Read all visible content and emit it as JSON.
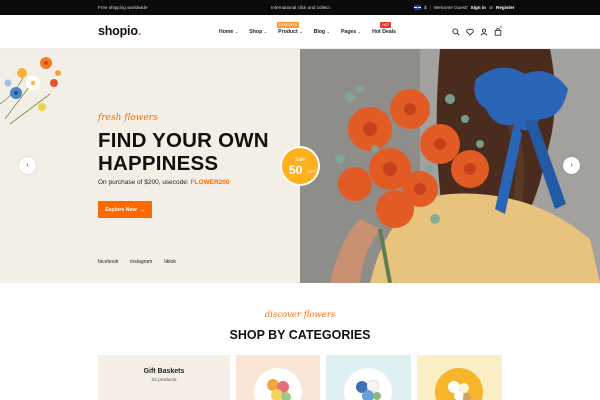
{
  "topbar": {
    "left_text": "Free shipping worldwide",
    "center_text": "International click and collect",
    "currency": "$",
    "welcome": "Welcome Guest!",
    "signin": "Sign in",
    "or": "or",
    "register": "Register"
  },
  "header": {
    "logo": "shopio",
    "logo_dot": ".",
    "nav": [
      {
        "label": "Home"
      },
      {
        "label": "Shop"
      },
      {
        "label": "Product",
        "badge": "FEATURED"
      },
      {
        "label": "Blog"
      },
      {
        "label": "Pages"
      },
      {
        "label": "Hot Deals",
        "badge": "HOT"
      }
    ],
    "cart_count": "0",
    "icons": [
      "search-icon",
      "heart-icon",
      "user-icon",
      "cart-icon"
    ]
  },
  "hero": {
    "tagline": "fresh flowers",
    "headline_line1": "FIND YOUR OWN",
    "headline_line2": "HAPPINESS",
    "sub_prefix": "On purchase of $200, usecode:",
    "promo_code": "FLOWER200",
    "cta_label": "Explore Now",
    "cta_arrow": "→",
    "socials": [
      "facebook",
      "instagram",
      "tiktok"
    ],
    "sale": {
      "label": "Sale",
      "value": "50",
      "suffix": "OFF"
    },
    "prev_arrow": "‹",
    "next_arrow": "›"
  },
  "categories": {
    "tagline": "discover flowers",
    "title": "SHOP BY CATEGORIES",
    "items": [
      {
        "name": "Gift Baskets",
        "count": "24 products"
      }
    ]
  },
  "colors": {
    "accent": "#ff6a00",
    "hero_bg": "#f3efe6",
    "topbar_bg": "#0b0b0b",
    "sale_badge": "#ffb01f"
  }
}
